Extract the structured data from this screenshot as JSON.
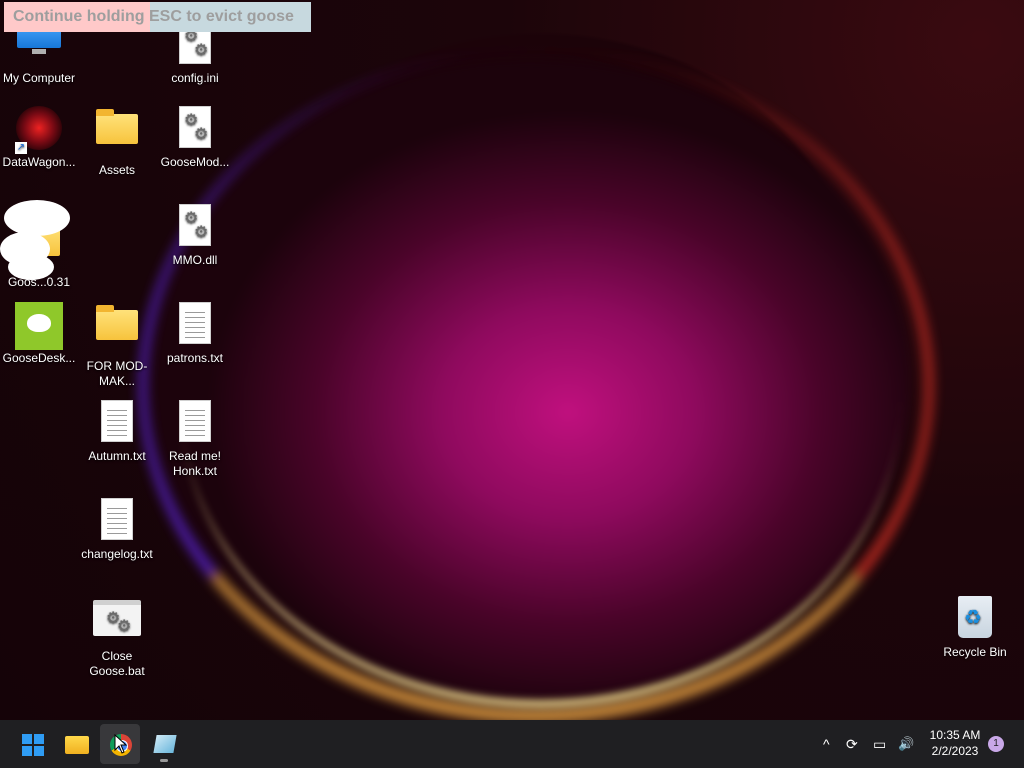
{
  "banner": {
    "text": "Continue holding ESC to evict goose"
  },
  "desktop_icons": [
    {
      "label": "My Computer",
      "icon": "monitor-icon"
    },
    {
      "label": "config.ini",
      "icon": "settings-file-icon"
    },
    {
      "label": "DataWagon...",
      "icon": "datawagon-icon"
    },
    {
      "label": "Assets",
      "icon": "folder-icon"
    },
    {
      "label": "GooseMod...",
      "icon": "settings-file-icon"
    },
    {
      "label": "MMO.dll",
      "icon": "settings-file-icon"
    },
    {
      "label": "Goos...0.31",
      "icon": "folder-icon"
    },
    {
      "label": "GooseDesk...",
      "icon": "goose-desktop-icon"
    },
    {
      "label": "FOR MOD-MAK...",
      "icon": "folder-icon"
    },
    {
      "label": "patrons.txt",
      "icon": "text-file-icon"
    },
    {
      "label": "Autumn.txt",
      "icon": "text-file-icon"
    },
    {
      "label": "Read me! Honk.txt",
      "icon": "text-file-icon"
    },
    {
      "label": "changelog.txt",
      "icon": "text-file-icon"
    },
    {
      "label": "Close Goose.bat",
      "icon": "batch-file-icon"
    },
    {
      "label": "Recycle Bin",
      "icon": "recycle-bin-icon"
    }
  ],
  "taskbar": {
    "apps": [
      {
        "name": "Start",
        "icon": "windows-start-icon"
      },
      {
        "name": "File Explorer",
        "icon": "file-explorer-icon"
      },
      {
        "name": "Google Chrome",
        "icon": "chrome-icon",
        "active": true
      },
      {
        "name": "Desktop Goose",
        "icon": "app-icon",
        "running": true
      }
    ],
    "tray": {
      "chevron": "^",
      "sync": "⟳",
      "network": "▭",
      "volume": "🔊"
    },
    "clock": {
      "time": "10:35 AM",
      "date": "2/2/2023"
    },
    "notifications": "1"
  }
}
